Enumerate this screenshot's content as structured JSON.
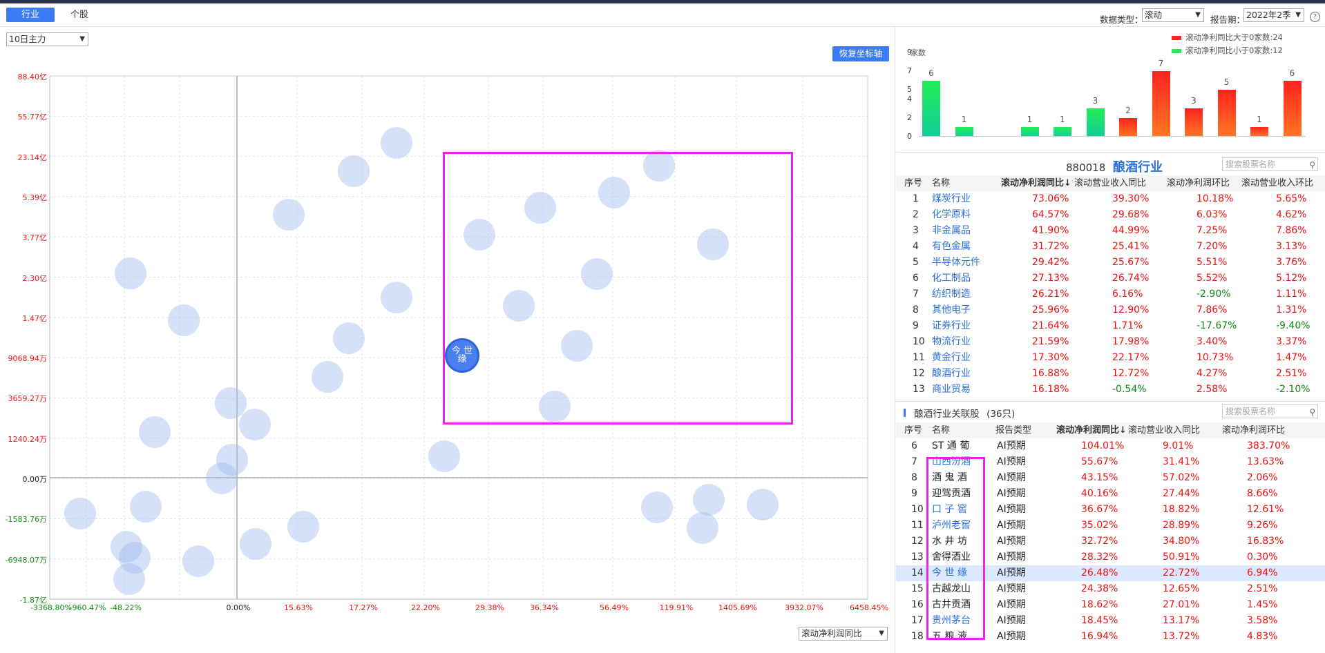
{
  "tabs": {
    "industry": "行业",
    "stock": "个股"
  },
  "header": {
    "data_type_label": "数据类型：",
    "data_type_value": "滚动",
    "report_label": "报告期：",
    "report_value": "2022年2季",
    "help": "?"
  },
  "left": {
    "period_select": "10日主力",
    "restore_button": "恢复坐标轴",
    "x_metric_select": "滚动净利润同比"
  },
  "chart_data": {
    "type": "scatter",
    "y_ticks": [
      "88.40亿",
      "55.77亿",
      "23.14亿",
      "5.39亿",
      "3.77亿",
      "2.30亿",
      "1.47亿",
      "9068.94万",
      "3659.27万",
      "1240.24万",
      "0.00万",
      "-1583.76万",
      "-6948.07万",
      "-1.87亿"
    ],
    "x_ticks": [
      "-3368.80%",
      "-960.47%",
      "-48.22%",
      "-0.00%",
      "0.00%",
      "15.63%",
      "17.27%",
      "22.20%",
      "29.38%",
      "36.34%",
      "56.49%",
      "119.91%",
      "1405.69%",
      "3932.07%",
      "6458.45%"
    ],
    "selected_label": "今 世 缘"
  },
  "histogram": {
    "legend_up": "滚动净利同比大于0家数:24",
    "legend_down": "滚动净利同比小于0家数:12",
    "ylabel": "家数",
    "yticks": [
      "9",
      "7",
      "5",
      "4",
      "2",
      "0"
    ],
    "bars": [
      {
        "v": 6,
        "c": "g"
      },
      {
        "v": 1,
        "c": "g"
      },
      {
        "v": 0,
        "c": "g"
      },
      {
        "v": 1,
        "c": "g"
      },
      {
        "v": 1,
        "c": "g"
      },
      {
        "v": 3,
        "c": "g"
      },
      {
        "v": 2,
        "c": "r"
      },
      {
        "v": 7,
        "c": "r"
      },
      {
        "v": 3,
        "c": "r"
      },
      {
        "v": 5,
        "c": "r"
      },
      {
        "v": 1,
        "c": "r"
      },
      {
        "v": 6,
        "c": "r"
      }
    ],
    "labels": [
      "6",
      "1",
      "",
      "1",
      "1",
      "3",
      "2",
      "7",
      "3",
      "5",
      "1",
      "6"
    ]
  },
  "industry": {
    "code": "880018",
    "name": "酿酒行业",
    "search_placeholder": "搜索股票名称",
    "headers": [
      "序号",
      "名称",
      "滚动净利润同比↓",
      "滚动营业收入同比",
      "滚动净利润环比",
      "滚动营业收入环比"
    ],
    "rows": [
      [
        "1",
        "煤炭行业",
        "73.06%",
        "39.30%",
        "10.18%",
        "5.65%"
      ],
      [
        "2",
        "化学原料",
        "64.57%",
        "29.68%",
        "6.03%",
        "4.62%"
      ],
      [
        "3",
        "非金属品",
        "41.90%",
        "44.99%",
        "7.25%",
        "7.86%"
      ],
      [
        "4",
        "有色金属",
        "31.72%",
        "25.41%",
        "7.20%",
        "3.13%"
      ],
      [
        "5",
        "半导体元件",
        "29.42%",
        "25.67%",
        "5.51%",
        "3.76%"
      ],
      [
        "6",
        "化工制品",
        "27.13%",
        "26.74%",
        "5.52%",
        "5.12%"
      ],
      [
        "7",
        "纺织制造",
        "26.21%",
        "6.16%",
        "-2.90%",
        "1.11%"
      ],
      [
        "8",
        "其他电子",
        "25.96%",
        "12.90%",
        "7.86%",
        "1.31%"
      ],
      [
        "9",
        "证券行业",
        "21.64%",
        "1.71%",
        "-17.67%",
        "-9.40%"
      ],
      [
        "10",
        "物流行业",
        "21.59%",
        "17.98%",
        "3.40%",
        "3.37%"
      ],
      [
        "11",
        "黄金行业",
        "17.30%",
        "22.17%",
        "10.73%",
        "1.47%"
      ],
      [
        "12",
        "酿酒行业",
        "16.88%",
        "12.72%",
        "4.27%",
        "2.51%"
      ],
      [
        "13",
        "商业贸易",
        "16.18%",
        "-0.54%",
        "2.58%",
        "-2.10%"
      ]
    ]
  },
  "related": {
    "title": "酿酒行业关联股",
    "count": "(36只)",
    "search_placeholder": "搜索股票名称",
    "headers": [
      "序号",
      "名称",
      "报告类型",
      "滚动净利润同比↓",
      "滚动营业收入同比",
      "滚动净利润环比"
    ],
    "rows": [
      [
        "6",
        "ST 通 葡",
        "AI预期",
        "104.01%",
        "9.01%",
        "383.70%"
      ],
      [
        "7",
        "山西汾酒",
        "AI预期",
        "55.67%",
        "31.41%",
        "13.63%"
      ],
      [
        "8",
        "酒 鬼 酒",
        "AI预期",
        "43.15%",
        "57.02%",
        "2.06%"
      ],
      [
        "9",
        "迎驾贡酒",
        "AI预期",
        "40.16%",
        "27.44%",
        "8.66%"
      ],
      [
        "10",
        "口 子 窖",
        "AI预期",
        "36.67%",
        "18.82%",
        "12.61%"
      ],
      [
        "11",
        "泸州老窖",
        "AI预期",
        "35.02%",
        "28.89%",
        "9.26%"
      ],
      [
        "12",
        "水 井 坊",
        "AI预期",
        "32.72%",
        "34.80%",
        "16.83%"
      ],
      [
        "13",
        "舍得酒业",
        "AI预期",
        "28.32%",
        "50.91%",
        "0.30%"
      ],
      [
        "14",
        "今 世 缘",
        "AI预期",
        "26.48%",
        "22.72%",
        "6.94%"
      ],
      [
        "15",
        "古越龙山",
        "AI预期",
        "24.38%",
        "12.65%",
        "2.51%"
      ],
      [
        "16",
        "古井贡酒",
        "AI预期",
        "18.62%",
        "27.01%",
        "1.45%"
      ],
      [
        "17",
        "贵州茅台",
        "AI预期",
        "18.45%",
        "13.17%",
        "3.58%"
      ],
      [
        "18",
        "五 粮 液",
        "AI预期",
        "16.94%",
        "13.72%",
        "4.83%"
      ]
    ]
  }
}
